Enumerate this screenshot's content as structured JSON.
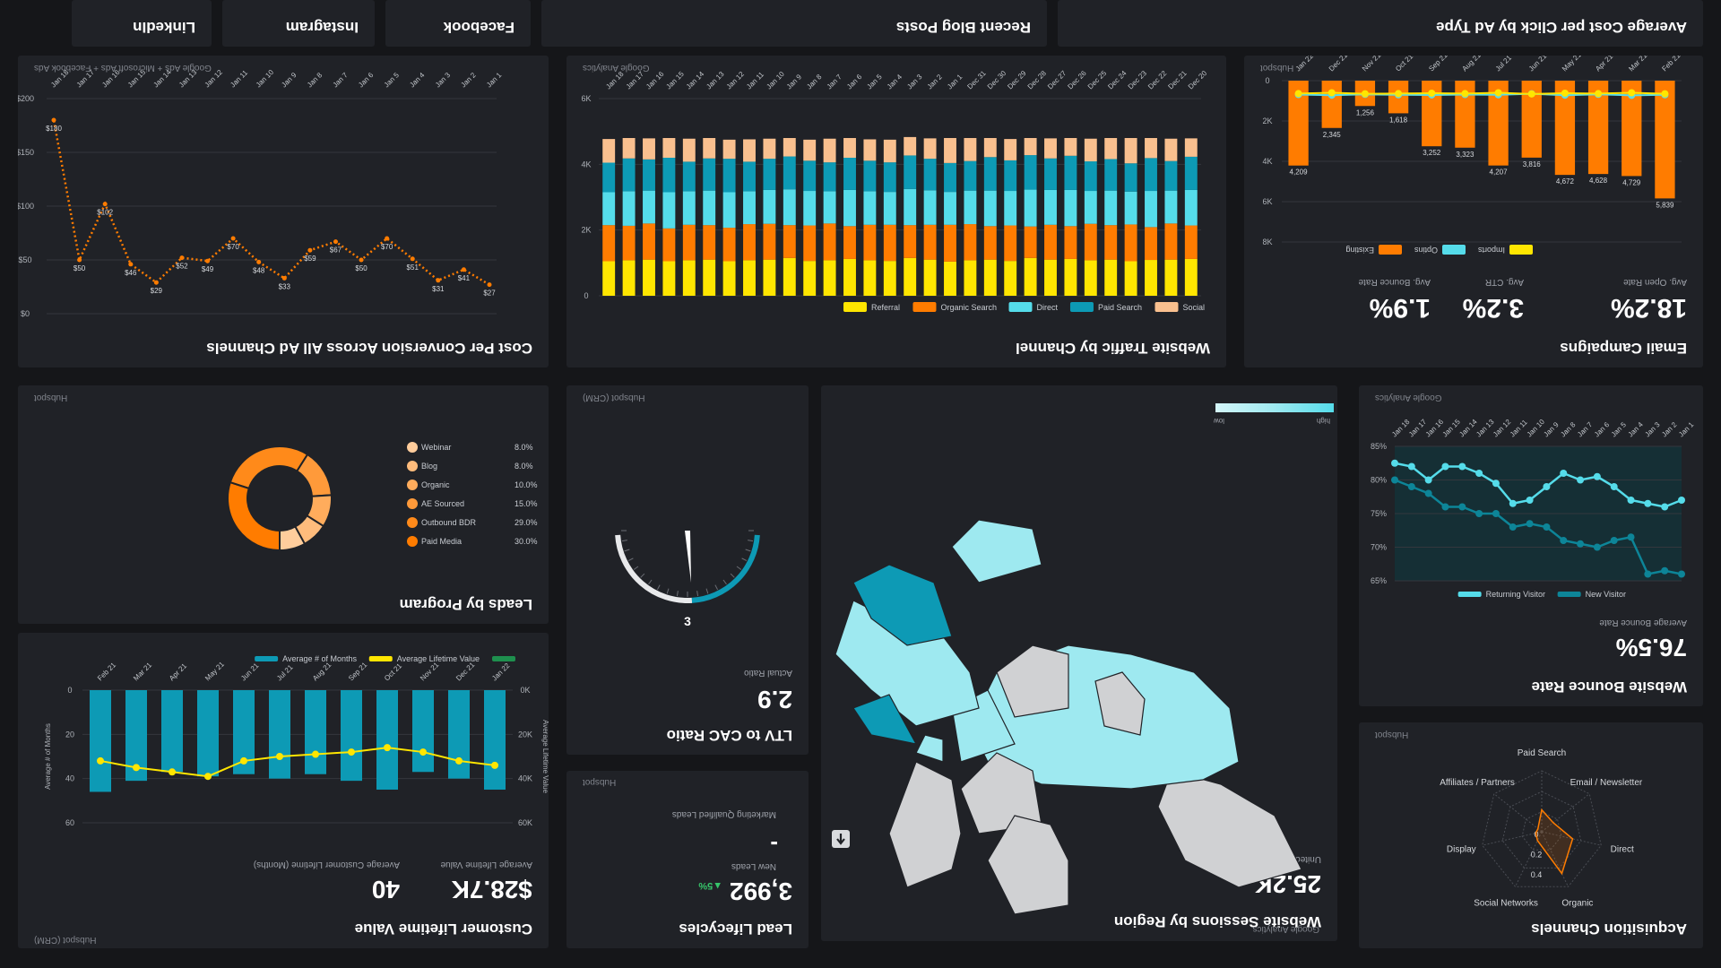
{
  "colors": {
    "bg": "#151619",
    "panel": "#202227",
    "orange": "#ff7c00",
    "cyan": "#55dcea",
    "teal": "#0d9ab5",
    "yellow": "#ffe600",
    "peach": "#f9c08f",
    "green": "#36c46a",
    "light": "#9ee9f0"
  },
  "top_panels": {
    "cpc_title": "Average Cost per Click by Ad Type",
    "blog_title": "Recent Blog Posts",
    "facebook_title": "Facebook",
    "instagram_title": "Instagram",
    "linkedin_title": "LinkedIn"
  },
  "cost_per_conversion": {
    "title": "Cost Per Conversion Across All Ad Channels",
    "source": "Google Ads + Microsoft Ads + Facebook Ads"
  },
  "website_traffic": {
    "title": "Website Traffic by Channel",
    "source": "Google Analytics"
  },
  "email": {
    "title": "Email Campaigns",
    "source": "Hubspot",
    "open_rate_label": "Avg. Open Rate",
    "open_rate": "18.2%",
    "ctr_label": "Avg. CTR",
    "ctr": "3.2%",
    "bounce_label": "Avg. Bounce Rate",
    "bounce": "1.9%"
  },
  "leads_by_program": {
    "title": "Leads by Program",
    "source": "Hubspot"
  },
  "ltv_cac": {
    "title": "LTV to CAC Ratio",
    "source": "Hubspot (CRM)",
    "value_label": "Actual Ratio",
    "value": "2.9",
    "gauge_target": "3"
  },
  "sessions_region": {
    "title": "Website Sessions by Region",
    "source": "Google Analytics",
    "value_label": "United States Sessions",
    "value": "25.2K",
    "legend_low": "low",
    "legend_high": "high"
  },
  "bounce_rate": {
    "title": "Website Bounce Rate",
    "source": "Google Analytics",
    "value_label": "Average Bounce Rate",
    "value": "76.5%"
  },
  "clv": {
    "title": "Customer Lifetime Value",
    "source": "Hubspot (CRM)",
    "value1_label": "Average Lifetime Value",
    "value1": "$28.7K",
    "value2_label": "Average Customer Lifetime (Months)",
    "value2": "40"
  },
  "lead_lifecycles": {
    "title": "Lead Lifecycles",
    "source": "Hubspot",
    "mql_label": "Marketing Qualified Leads",
    "mql_value": "-",
    "new_leads_label": "New Leads",
    "new_leads": "3,992",
    "delta": "▲5%"
  },
  "acquisition": {
    "title": "Acquisition Channels",
    "source": "Hubspot"
  },
  "chart_data": [
    {
      "id": "cost_per_conversion",
      "type": "line",
      "categories": [
        "Jan 1",
        "Jan 2",
        "Jan 3",
        "Jan 4",
        "Jan 5",
        "Jan 6",
        "Jan 7",
        "Jan 8",
        "Jan 9",
        "Jan 10",
        "Jan 11",
        "Jan 12",
        "Jan 13",
        "Jan 14",
        "Jan 15",
        "Jan 16",
        "Jan 17",
        "Jan 18"
      ],
      "values": [
        27,
        41,
        31,
        51,
        70,
        50,
        67,
        59,
        33,
        48,
        70,
        49,
        52,
        29,
        46,
        102,
        50,
        180
      ],
      "data_labels": [
        "$27",
        "$41",
        "$31",
        "$51",
        "$70",
        "$50",
        "$67",
        "$59",
        "$33",
        "$48",
        "$70",
        "$49",
        "$52",
        "$29",
        "$46",
        "$102",
        "$50",
        "$180"
      ],
      "yticks": [
        "$0",
        "$50",
        "$100",
        "$150",
        "$200"
      ],
      "ylim": [
        0,
        200
      ],
      "color": "#ff7c00"
    },
    {
      "id": "website_traffic",
      "type": "bar",
      "stacked": true,
      "categories": [
        "Dec 20",
        "Dec 21",
        "Dec 22",
        "Dec 23",
        "Dec 24",
        "Dec 25",
        "Dec 26",
        "Dec 27",
        "Dec 28",
        "Dec 29",
        "Dec 30",
        "Dec 31",
        "Jan 1",
        "Jan 2",
        "Jan 3",
        "Jan 4",
        "Jan 5",
        "Jan 6",
        "Jan 7",
        "Jan 8",
        "Jan 9",
        "Jan 10",
        "Jan 11",
        "Jan 12",
        "Jan 13",
        "Jan 14",
        "Jan 15",
        "Jan 16",
        "Jan 17",
        "Jan 18"
      ],
      "yticks": [
        "0",
        "2K",
        "4K",
        "6K"
      ],
      "ylim": [
        0,
        6000
      ],
      "series": [
        {
          "name": "Social",
          "color": "#f9c08f",
          "values": [
            720,
            620,
            640,
            600,
            700,
            620,
            580,
            680,
            610,
            560,
            640,
            720,
            600,
            650,
            690,
            560,
            620,
            760,
            700,
            580,
            650,
            520,
            610,
            540,
            690,
            640,
            770,
            610,
            680,
            560
          ]
        },
        {
          "name": "Paid Search",
          "color": "#0d9ab5",
          "values": [
            900,
            1000,
            950,
            1050,
            900,
            980,
            1020,
            900,
            950,
            1000,
            920,
            880,
            980,
            930,
            900,
            1020,
            960,
            880,
            900,
            1020,
            930,
            1050,
            960,
            1040,
            900,
            960,
            860,
            1000,
            900,
            1010
          ]
        },
        {
          "name": "Direct",
          "color": "#55dcea",
          "values": [
            1000,
            1050,
            1000,
            1100,
            1020,
            1050,
            1080,
            1000,
            1030,
            1090,
            1050,
            980,
            1100,
            1020,
            1000,
            1100,
            1050,
            1000,
            1020,
            1080,
            1050,
            1120,
            1060,
            1100,
            1000,
            1050,
            1000,
            1100,
            1000,
            1080
          ]
        },
        {
          "name": "Organic Search",
          "color": "#ff7c00",
          "values": [
            1100,
            1050,
            1100,
            1000,
            1080,
            1050,
            1020,
            1100,
            1090,
            1000,
            1080,
            1120,
            1000,
            1080,
            1100,
            1000,
            1060,
            1120,
            1100,
            1020,
            1080,
            960,
            1060,
            1000,
            1110,
            1050,
            1120,
            1000,
            1100,
            1020
          ]
        },
        {
          "name": "Referral",
          "color": "#ffe600",
          "values": [
            1050,
            1080,
            1100,
            1050,
            1080,
            1100,
            1050,
            1080,
            1100,
            1150,
            1060,
            1080,
            1120,
            1080,
            1060,
            1150,
            1100,
            1040,
            1080,
            1100,
            1060,
            1150,
            1100,
            1120,
            1080,
            1100,
            1050,
            1090,
            1100,
            1120
          ]
        }
      ]
    },
    {
      "id": "email_campaigns",
      "type": "bar",
      "categories": [
        "Feb 21",
        "Mar 21",
        "Apr 21",
        "May 21",
        "Jun 21",
        "Jul 21",
        "Aug 21",
        "Sep 21",
        "Oct 21",
        "Nov 21",
        "Dec 21",
        "Jan 22"
      ],
      "yticks": [
        "0",
        "2K",
        "4K",
        "6K",
        "8K"
      ],
      "ylim": [
        0,
        8000
      ],
      "series": [
        {
          "name": "Existing",
          "color": "#ff7c00",
          "values": [
            5839,
            4729,
            4628,
            4672,
            3816,
            4207,
            3323,
            3252,
            1618,
            1256,
            2345,
            4209
          ]
        },
        {
          "name": "Optins",
          "color": "#55dcea",
          "values": [
            700,
            730,
            680,
            720,
            650,
            700,
            690,
            710,
            700,
            680,
            720,
            690
          ]
        },
        {
          "name": "Imports",
          "color": "#ffe600",
          "values": [
            650,
            600,
            640,
            620,
            660,
            600,
            640,
            620,
            640,
            650,
            600,
            640
          ]
        }
      ],
      "data_labels": [
        "5,839",
        "4,729",
        "4,628",
        "4,672",
        "3,816",
        "4,207",
        "3,323",
        "3,252",
        "1,618",
        "1,256",
        "2,345",
        "4,209"
      ]
    },
    {
      "id": "leads_by_program",
      "type": "pie",
      "donut": true,
      "categories": [
        "Paid Media",
        "Outbound BDR",
        "AE Sourced",
        "Organic",
        "Blog",
        "Webinar"
      ],
      "values": [
        30,
        29,
        15,
        10,
        8,
        8
      ],
      "value_labels": [
        "30.0%",
        "29.0%",
        "15.0%",
        "10.0%",
        "8.0%",
        "8.0%"
      ],
      "colors": [
        "#ff7c00",
        "#ff8a1a",
        "#ff9a3a",
        "#ffac5c",
        "#ffbc7c",
        "#ffcd9c"
      ]
    },
    {
      "id": "website_bounce_rate",
      "type": "line",
      "categories": [
        "Jan 1",
        "Jan 2",
        "Jan 3",
        "Jan 4",
        "Jan 5",
        "Jan 6",
        "Jan 7",
        "Jan 8",
        "Jan 9",
        "Jan 10",
        "Jan 11",
        "Jan 12",
        "Jan 13",
        "Jan 14",
        "Jan 15",
        "Jan 16",
        "Jan 17",
        "Jan 18"
      ],
      "yticks": [
        "65%",
        "70%",
        "75%",
        "80%",
        "85%"
      ],
      "ylim": [
        65,
        85
      ],
      "series": [
        {
          "name": "New Visitor",
          "color": "#0d8598",
          "values": [
            66,
            66.5,
            66,
            71.5,
            71,
            70,
            70.5,
            71,
            73,
            73.5,
            73,
            75,
            75,
            76,
            76,
            78,
            79,
            80
          ]
        },
        {
          "name": "Returning Visitor",
          "color": "#55dcea",
          "values": [
            77,
            76,
            76.5,
            77,
            79,
            80.5,
            80,
            81,
            79,
            77,
            76.5,
            79.5,
            81,
            82,
            82,
            80,
            82,
            82.5
          ]
        }
      ]
    },
    {
      "id": "customer_lifetime_value",
      "type": "bar",
      "categories": [
        "Jan 22",
        "Dec 21",
        "Nov 21",
        "Oct 21",
        "Sep 21",
        "Aug 21",
        "Jul 21",
        "Jun 21",
        "May 21",
        "Apr 21",
        "Mar 21",
        "Feb 21"
      ],
      "yticks_left": [
        "0",
        "20",
        "40",
        "60"
      ],
      "yticks_right": [
        "0K",
        "20K",
        "40K",
        "60K"
      ],
      "ylabel_left": "Average # of Months",
      "ylabel_right": "Average Lifetime Value",
      "series": [
        {
          "name": "Average # of Months",
          "color": "#0d9ab5",
          "values": [
            45,
            40,
            37,
            45,
            41,
            38,
            40,
            38,
            39,
            37,
            41,
            46
          ]
        },
        {
          "name": "Average Lifetime Value",
          "color": "#ffe600",
          "values": [
            34,
            32,
            28,
            26,
            28,
            29,
            30,
            32,
            39,
            37,
            35,
            32
          ]
        },
        {
          "name": "",
          "color": "#1e8f4e",
          "values": []
        }
      ]
    },
    {
      "id": "acquisition_channels",
      "type": "radar",
      "categories": [
        "Paid Search",
        "Email / Newsletter",
        "Direct",
        "Organic",
        "Social Networks",
        "Display",
        "Affiliates / Partners"
      ],
      "rticks": [
        "0",
        "0.2",
        "0.4"
      ],
      "values": [
        0.18,
        0.12,
        0.26,
        0.38,
        0.08,
        0.05,
        0.04
      ],
      "color": "#ff7c00"
    }
  ]
}
